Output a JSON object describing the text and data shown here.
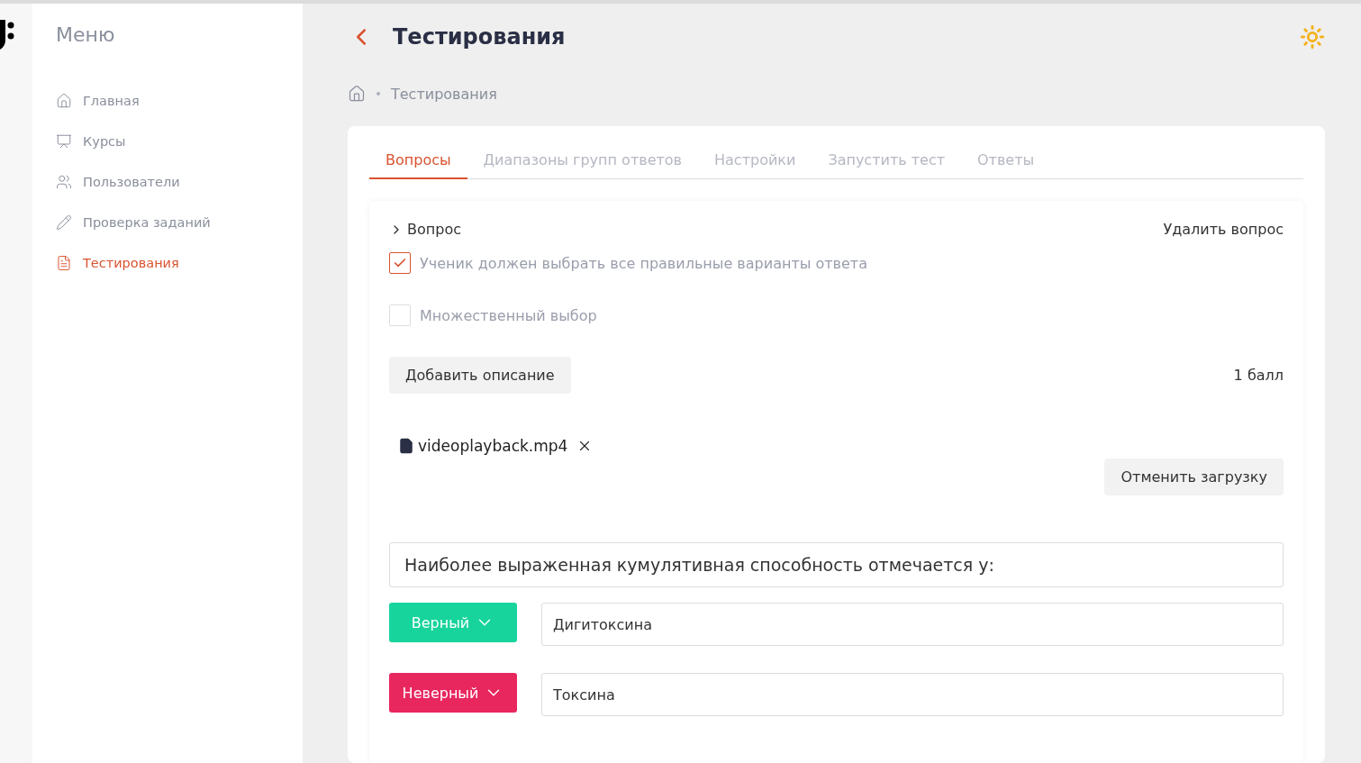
{
  "sidebar": {
    "title": "Меню",
    "items": [
      {
        "label": "Главная",
        "selected": false
      },
      {
        "label": "Курсы",
        "selected": false
      },
      {
        "label": "Пользователи",
        "selected": false
      },
      {
        "label": "Проверка заданий",
        "selected": false
      },
      {
        "label": "Тестирования",
        "selected": true
      }
    ]
  },
  "header": {
    "title": "Тестирования"
  },
  "breadcrumb": {
    "current": "Тестирования"
  },
  "tabs": [
    {
      "label": "Вопросы",
      "selected": true
    },
    {
      "label": "Диапазоны групп ответов",
      "selected": false
    },
    {
      "label": "Настройки",
      "selected": false
    },
    {
      "label": "Запустить тест",
      "selected": false
    },
    {
      "label": "Ответы",
      "selected": false
    }
  ],
  "question": {
    "title": "Вопрос",
    "delete_label": "Удалить вопрос",
    "options": [
      {
        "label": "Ученик должен выбрать все правильные варианты ответа",
        "checked": true
      },
      {
        "label": "Множественный выбор",
        "checked": false
      }
    ],
    "add_description": "Добавить описание",
    "points": "1 балл",
    "file": {
      "name": "videoplayback.mp4"
    },
    "cancel_upload": "Отменить загрузку",
    "text": "Наиболее выраженная кумулятивная способность отмечается у:",
    "answers": [
      {
        "kind": "correct",
        "status": "Верный",
        "value": "Дигитоксина"
      },
      {
        "kind": "incorrect",
        "status": "Неверный",
        "value": "Токсина"
      }
    ]
  }
}
